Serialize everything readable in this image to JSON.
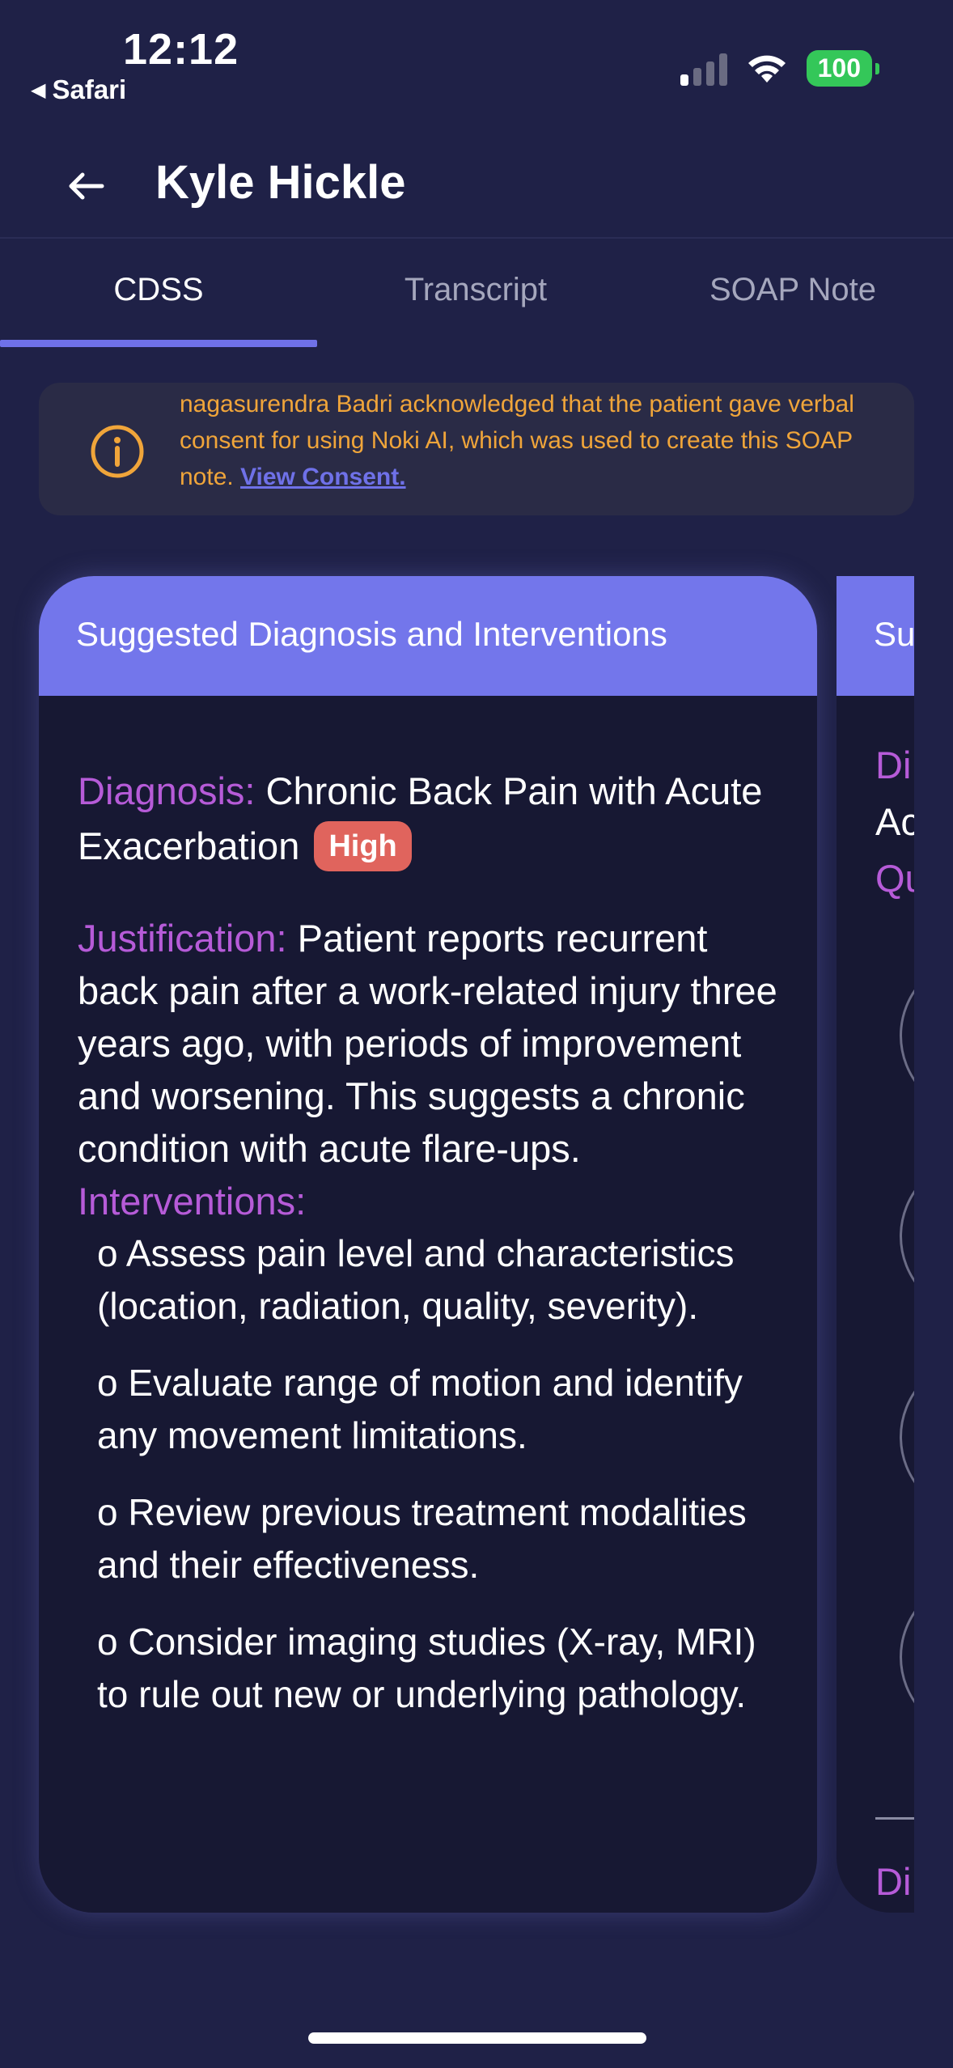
{
  "status_bar": {
    "time": "12:12",
    "back_app": "Safari",
    "battery": "100"
  },
  "header": {
    "title": "Kyle Hickle"
  },
  "tabs": [
    {
      "label": "CDSS",
      "active": true
    },
    {
      "label": "Transcript",
      "active": false
    },
    {
      "label": "SOAP Note",
      "active": false
    }
  ],
  "consent": {
    "text": "nagasurendra Badri acknowledged that the patient gave verbal consent for using Noki AI, which was used to create this SOAP note. ",
    "link": "View Consent."
  },
  "card": {
    "title": "Suggested Diagnosis and Interventions",
    "diagnosis_label": "Diagnosis:",
    "diagnosis": " Chronic Back Pain with Acute Exacerbation",
    "priority_badge": "High",
    "justification_label": "Justification:",
    "justification": " Patient reports recurrent back pain after a work-related injury three years ago, with periods of improvement and worsening. This suggests a chronic condition with acute flare-ups.",
    "interventions_label": "Interventions:",
    "interventions": [
      "o Assess pain level and characteristics (location, radiation, quality, severity).",
      "o Evaluate range of motion and identify any movement limitations.",
      "o Review previous treatment modalities and their effectiveness.",
      "o Consider imaging studies (X-ray, MRI) to rule out new or underlying pathology."
    ]
  },
  "card_next": {
    "title": "Su",
    "line1": "Di",
    "line2": "Ac",
    "line3": "Qu",
    "line4": "Di"
  },
  "colors": {
    "background": "#1f2147",
    "accent": "#6f71e8",
    "card_header": "#7376eb",
    "label": "#b65bd8",
    "warning": "#f0a53a",
    "badge_high": "#e0645d"
  }
}
